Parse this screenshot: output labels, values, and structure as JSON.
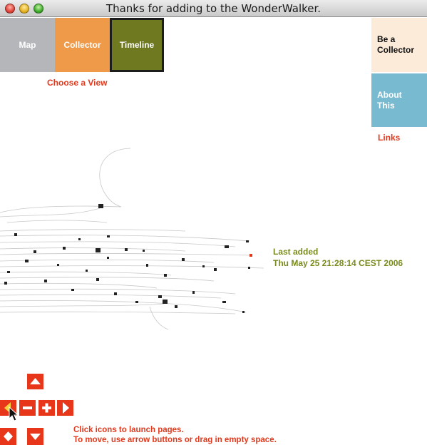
{
  "window": {
    "title": "Thanks for adding to the WonderWalker."
  },
  "views": {
    "map": "Map",
    "collector": "Collector",
    "timeline": "Timeline",
    "caption": "Choose a View"
  },
  "links": {
    "be_collector": "Be a Collector",
    "about": "About This",
    "caption": "Links"
  },
  "last_added": {
    "label": "Last added",
    "date": "Thu May 25 21:28:14 CEST 2006"
  },
  "instructions": {
    "line1": "Click icons to launch pages.",
    "line2": "To move, use arrow buttons or drag in empty space."
  },
  "colors": {
    "map": "#b4b6b9",
    "collector": "#ef9a48",
    "timeline": "#6f7a20",
    "be_collector_bg": "#fdebd9",
    "about_bg": "#78bad0",
    "accent_red": "#e03a1e",
    "olive_text": "#7a8a1c"
  },
  "icons": {
    "up": "arrow-up-icon",
    "left": "arrow-left-icon",
    "zoom_out": "minus-icon",
    "zoom_in": "plus-icon",
    "right": "arrow-right-icon",
    "diamond": "diamond-icon",
    "down": "arrow-down-icon",
    "cursor": "mouse-pointer-icon"
  }
}
